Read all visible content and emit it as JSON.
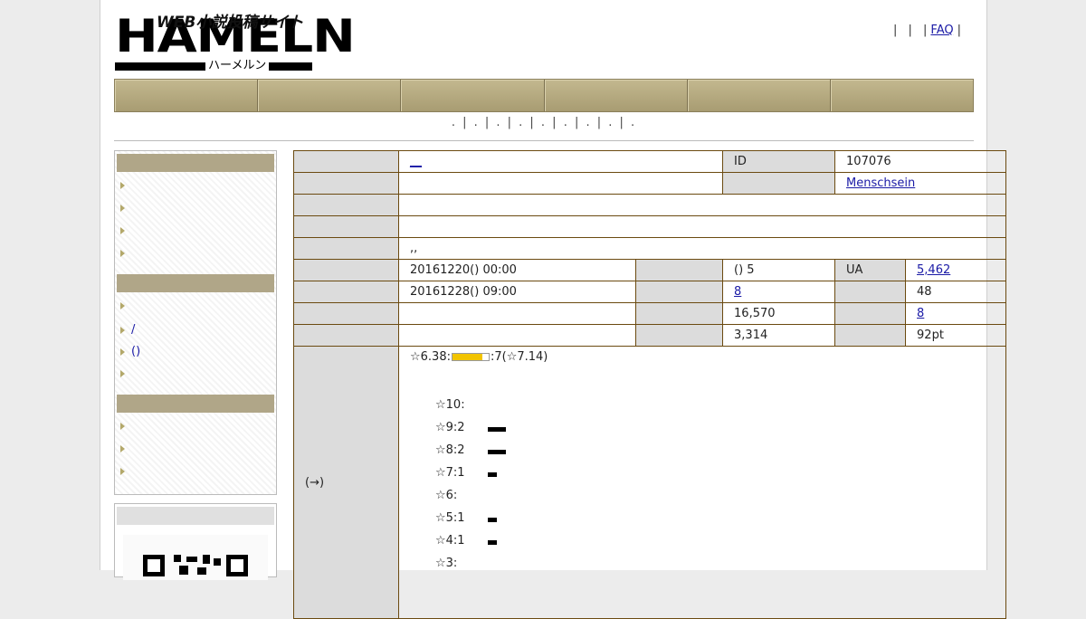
{
  "logo": {
    "main": "HAMELN",
    "tagline": "WEB小説投稿サイト",
    "kana": "ハーメルン"
  },
  "toplinks": {
    "faq": "FAQ"
  },
  "subnav": ". | . | . | . | . | . | . | . | .",
  "info": {
    "title_link": "__",
    "id_label": "ID",
    "id_value": "107076",
    "author": "Menschsein",
    "tags_text": ",,",
    "published": "20161220() 00:00",
    "updated": "20161228() 09:00",
    "episodes": "() 5",
    "ua_label": "UA",
    "ua_value": "5,462",
    "favorites_link": "8",
    "value_48": "48",
    "chars": "16,570",
    "reviews_link": "8",
    "avg_chars": "3,314",
    "points": "92pt",
    "rating_prefix": "☆6.38:",
    "rating_suffix": ":7(☆7.14)",
    "rating_fill": 0.82,
    "rating_row_label": "(→)",
    "histogram": [
      {
        "label": "☆10:",
        "count": 0
      },
      {
        "label": "☆9:2",
        "count": 2
      },
      {
        "label": "☆8:2",
        "count": 2
      },
      {
        "label": "☆7:1",
        "count": 1
      },
      {
        "label": "☆6:",
        "count": 0
      },
      {
        "label": "☆5:1",
        "count": 1
      },
      {
        "label": "☆4:1",
        "count": 1
      },
      {
        "label": "☆3:",
        "count": 0
      }
    ]
  },
  "sidebar": {
    "item_slash": "/",
    "item_paren": "()"
  }
}
